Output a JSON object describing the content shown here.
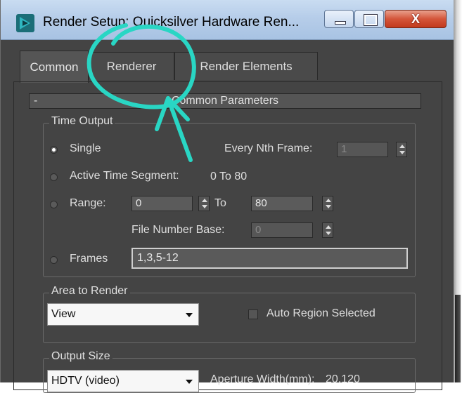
{
  "window": {
    "title": "Render Setup: Quicksilver Hardware Ren...",
    "controls": {
      "minimize": "minimize",
      "maximize": "maximize",
      "close": "X"
    }
  },
  "tabs": [
    {
      "label": "Common",
      "active": true
    },
    {
      "label": "Renderer",
      "active": false
    },
    {
      "label": "Render Elements",
      "active": false
    }
  ],
  "rollout": {
    "toggle": "-",
    "title": "Common Parameters"
  },
  "time_output": {
    "group_title": "Time Output",
    "single": {
      "label": "Single",
      "selected": true
    },
    "every_nth": {
      "label": "Every Nth Frame:",
      "value": "1"
    },
    "active_segment": {
      "label": "Active Time Segment:",
      "value": "0 To 80"
    },
    "range": {
      "label": "Range:",
      "from": "0",
      "to_label": "To",
      "to": "80"
    },
    "file_number_base": {
      "label": "File Number Base:",
      "value": "0"
    },
    "frames": {
      "label": "Frames",
      "value": "1,3,5-12"
    }
  },
  "area_to_render": {
    "group_title": "Area to Render",
    "selected": "View",
    "auto_region": {
      "label": "Auto Region Selected",
      "checked": false
    }
  },
  "output_size": {
    "group_title": "Output Size",
    "selected": "HDTV (video)",
    "aperture_label": "Aperture Width(mm):",
    "aperture_value": "20.120"
  },
  "colors": {
    "panel_bg": "#444444",
    "annotation": "#29d6c4"
  }
}
